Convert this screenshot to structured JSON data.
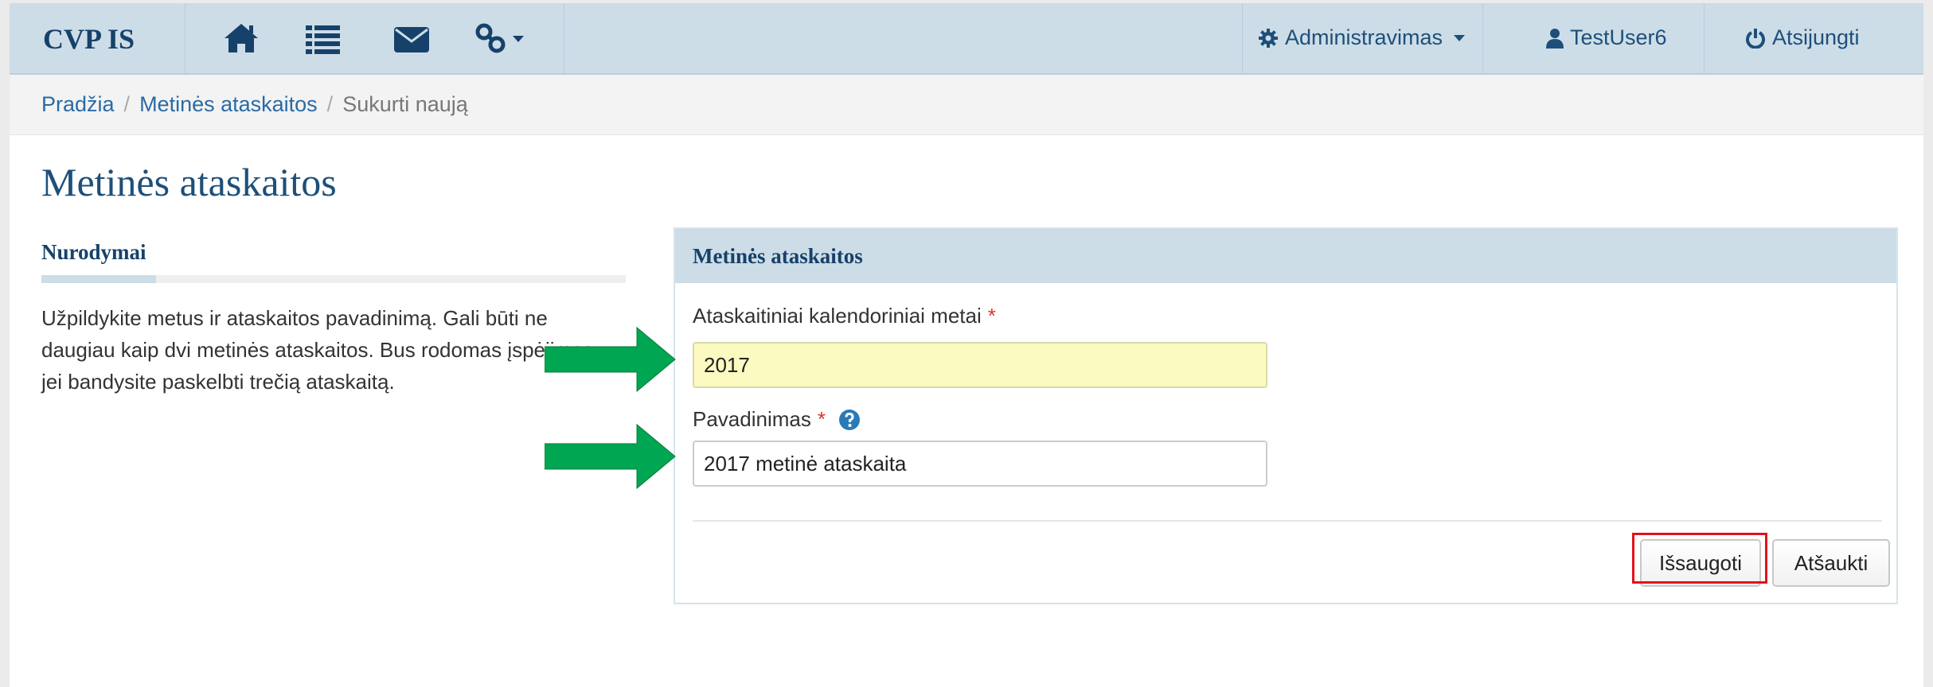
{
  "navbar": {
    "brand": "CVP IS",
    "icons": [
      "home-icon",
      "list-icon",
      "envelope-icon",
      "link-icon"
    ],
    "admin_label": "Administravimas",
    "user_label": "TestUser6",
    "logout_label": "Atsijungti"
  },
  "breadcrumb": {
    "items": [
      "Pradžia",
      "Metinės ataskaitos",
      "Sukurti naują"
    ],
    "separator": "/"
  },
  "page": {
    "title": "Metinės ataskaitos"
  },
  "instructions": {
    "heading": "Nurodymai",
    "text": "Užpildykite metus ir ataskaitos pavadinimą. Gali būti ne daugiau kaip dvi metinės ataskaitos. Bus rodomas įspėjimas jei bandysite paskelbti trečią ataskaitą."
  },
  "form": {
    "panel_title": "Metinės ataskaitos",
    "year_label": "Ataskaitiniai kalendoriniai metai",
    "year_value": "2017",
    "name_label": "Pavadinimas",
    "name_value": "2017 metinė ataskaita",
    "required_mark": "*",
    "save_label": "Išsaugoti",
    "cancel_label": "Atšaukti"
  },
  "colors": {
    "navbar_bg": "#cddde7",
    "brand": "#16416a",
    "link": "#2a6aa5",
    "required": "#d9362c",
    "highlight_box": "#e3121b",
    "arrow": "#00a651",
    "input_highlight": "#fbfbc1"
  }
}
